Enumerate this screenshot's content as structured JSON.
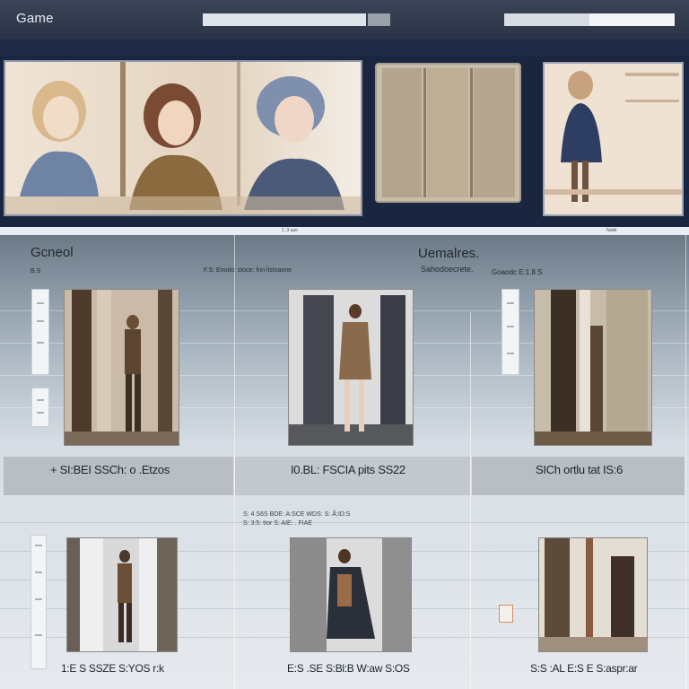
{
  "app": {
    "title": "Game"
  },
  "header": {
    "search_placeholder": "",
    "right_field_value": ""
  },
  "gallery": {
    "captions": [
      "1 :3 aze",
      "Nebil"
    ]
  },
  "sections": {
    "left_title": "Gcneol",
    "left_subtitle": "B.S",
    "mid_subtitle": "F.S: Emolo: stoce: fnn listnaone",
    "center_title": "Uemalres.",
    "center_subtitle": "Sahodoecrete.",
    "right_subtitle": "Goaodc  E:1.8 S"
  },
  "cards_row1": [
    {
      "label": "+ SI:BEI  SSCh: o .Etzos"
    },
    {
      "label": "I0.BL: FSCIA  pits  SS22"
    },
    {
      "label": "SICh  ortlu tat  IS:6"
    }
  ],
  "mid_note": [
    "S: 4  S6S  BDE:  A:SCE  WDS: S: Å:ID:S",
    "S: 3:5:  ttor  S: AIE:  . FIAE"
  ],
  "cards_row2": [
    {
      "label": "1:E  S  SSZE  S:YOS  r:k"
    },
    {
      "label": "E:S  .SE  S:Bl:B  W:aw  S:OS"
    },
    {
      "label": "S:S  :AL  E:S  E  S:aspr:ar"
    }
  ],
  "colors": {
    "header": "#2b3346",
    "gallery_bg": "#1a2540",
    "band": "#b9bec4",
    "content_top": "#6c7a88",
    "content_bottom": "#e6eaee"
  },
  "icons": [
    "search-icon",
    "menu-icon"
  ]
}
